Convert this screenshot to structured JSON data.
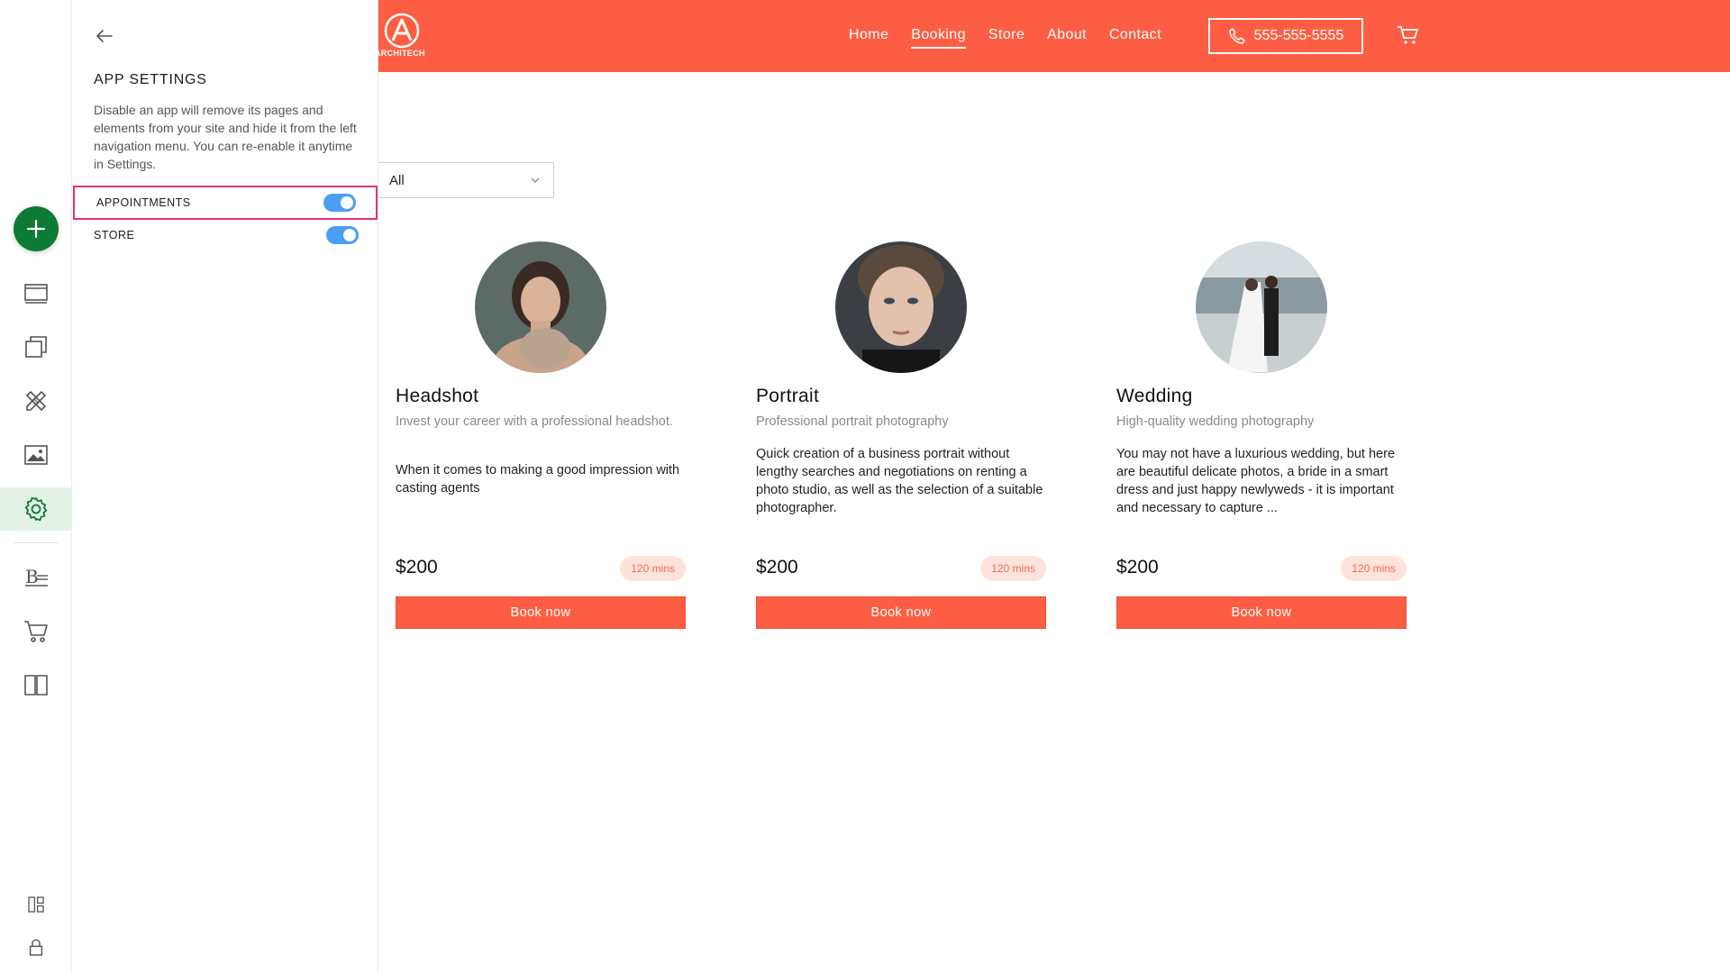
{
  "panel": {
    "title": "APP SETTINGS",
    "description": "Disable an app will remove its pages and elements  from your site and hide it from the left navigation menu. You can re-enable it anytime in Settings.",
    "apps": [
      {
        "label": "APPOINTMENTS",
        "enabled": true
      },
      {
        "label": "STORE",
        "enabled": true
      }
    ]
  },
  "rail": {
    "icons": [
      "plus-icon",
      "layout-icon",
      "pages-icon",
      "design-tools-icon",
      "image-icon",
      "gear-icon",
      "blog-icon",
      "cart-icon",
      "book-icon",
      "dashboard-icon",
      "lock-icon"
    ],
    "active": "gear-icon",
    "accent_color": "#0d7a35"
  },
  "site": {
    "brand_color": "#fd5e43",
    "logo_text": "ARCHITECH",
    "nav": [
      "Home",
      "Booking",
      "Store",
      "About",
      "Contact"
    ],
    "active_nav": "Booking",
    "phone": "555-555-5555",
    "filter": {
      "selected": "All"
    },
    "services": [
      {
        "title": "Headshot",
        "subtitle": "Invest your career with a professional headshot.",
        "description": "When it comes to making a good impression with casting agents",
        "price": "$200",
        "duration": "120 mins",
        "button": "Book now"
      },
      {
        "title": "Portrait",
        "subtitle": "Professional portrait photography",
        "description": "Quick creation of a business portrait without lengthy searches and negotiations on renting a photo studio, as well as the selection of a suitable photographer.",
        "price": "$200",
        "duration": "120 mins",
        "button": "Book now"
      },
      {
        "title": "Wedding",
        "subtitle": "High-quality wedding photography",
        "description": "You may not have a luxurious wedding, but here are beautiful delicate photos, a bride in a smart dress and just happy newlyweds - it is important and necessary to capture ...",
        "price": "$200",
        "duration": "120 mins",
        "button": "Book now"
      }
    ]
  }
}
